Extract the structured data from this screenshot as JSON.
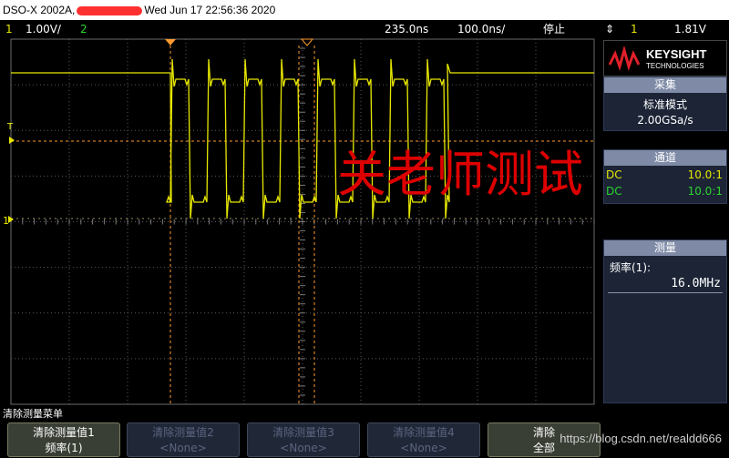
{
  "title_bar": {
    "model": "DSO-X 2002A,",
    "datetime": "Wed Jun 17 22:56:36 2020"
  },
  "status_bar": {
    "ch1_num": "1",
    "ch1_scale": "1.00V/",
    "ch2_num": "2",
    "delay": "235.0ns",
    "timebase": "100.0ns/",
    "run_state": "停止",
    "trigger_source": "1",
    "trigger_level": "1.81V"
  },
  "overlay_text": "关老师测试",
  "markers": {
    "trigger_t": "T",
    "channel_1": "1"
  },
  "brand": {
    "name": "KEYSIGHT",
    "sub": "TECHNOLOGIES"
  },
  "acquire": {
    "header": "采集",
    "mode": "标准模式",
    "rate": "2.00GSa/s"
  },
  "channels": {
    "header": "通道",
    "items": [
      {
        "coupling": "DC",
        "probe": "10.0:1",
        "color": "#e6e600"
      },
      {
        "coupling": "DC",
        "probe": "10.0:1",
        "color": "#2bd42b"
      }
    ]
  },
  "measure": {
    "header": "测量",
    "label": "频率(1):",
    "value": "16.0MHz"
  },
  "softkeys": {
    "menu_title": "清除测量菜单",
    "keys": [
      {
        "line1": "清除测量值1",
        "line2": "频率(1)",
        "state": "active"
      },
      {
        "line1": "清除测量值2",
        "line2": "<None>",
        "state": "dim"
      },
      {
        "line1": "清除测量值3",
        "line2": "<None>",
        "state": "dim"
      },
      {
        "line1": "清除测量值4",
        "line2": "<None>",
        "state": "dim"
      },
      {
        "line1": "清除",
        "line2": "全部",
        "state": "active"
      }
    ]
  },
  "watermark": "https://blog.csdn.net/realdd666",
  "colors": {
    "trace": "#e8e800",
    "cursor": "#ff9a2e",
    "grid": "#5a5a5a",
    "overlay": "#dd0000"
  }
}
